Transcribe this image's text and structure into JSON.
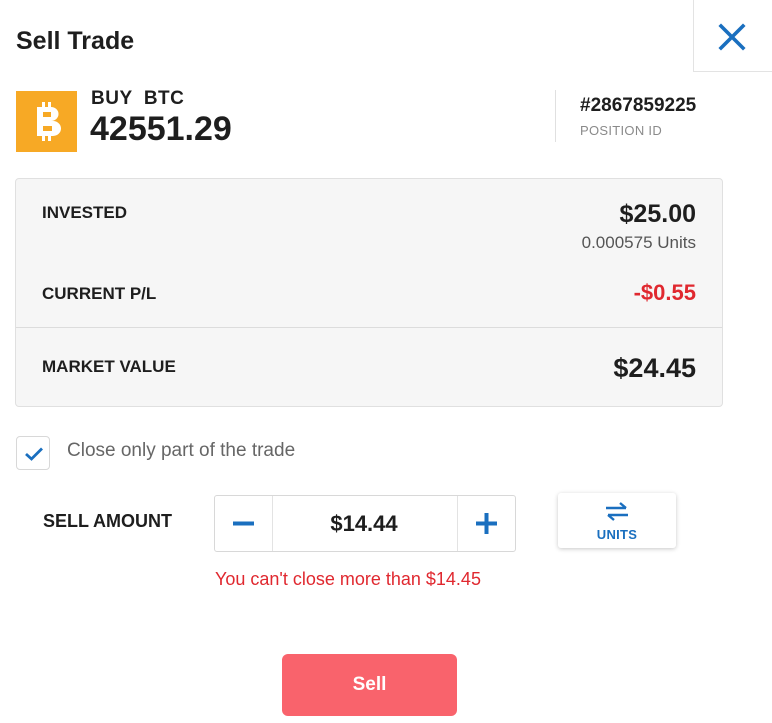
{
  "header": {
    "title": "Sell Trade",
    "close_icon": "close-icon"
  },
  "instrument": {
    "logo_icon": "bitcoin-icon",
    "logo_color": "#f7a925",
    "side": "BUY",
    "symbol": "BTC",
    "side_symbol": "BUY  BTC",
    "rate": "42551.29",
    "position_id": "#2867859225",
    "position_id_label": "POSITION ID"
  },
  "summary": {
    "invested_label": "INVESTED",
    "invested_value": "$25.00",
    "units": "0.000575 Units",
    "pl_label": "CURRENT P/L",
    "pl_value": "-$0.55",
    "pl_color": "#e0282f",
    "market_value_label": "MARKET VALUE",
    "market_value": "$24.45"
  },
  "partial_close": {
    "checked": true,
    "label": "Close only part of the trade"
  },
  "sell_amount": {
    "label": "SELL AMOUNT",
    "value": "$14.44",
    "minus_icon": "minus-icon",
    "plus_icon": "plus-icon",
    "units_toggle_label": "UNITS",
    "units_toggle_icon": "swap-arrows-icon",
    "error": "You can't close more than $14.45"
  },
  "actions": {
    "sell_label": "Sell",
    "sell_color": "#f9636c"
  }
}
